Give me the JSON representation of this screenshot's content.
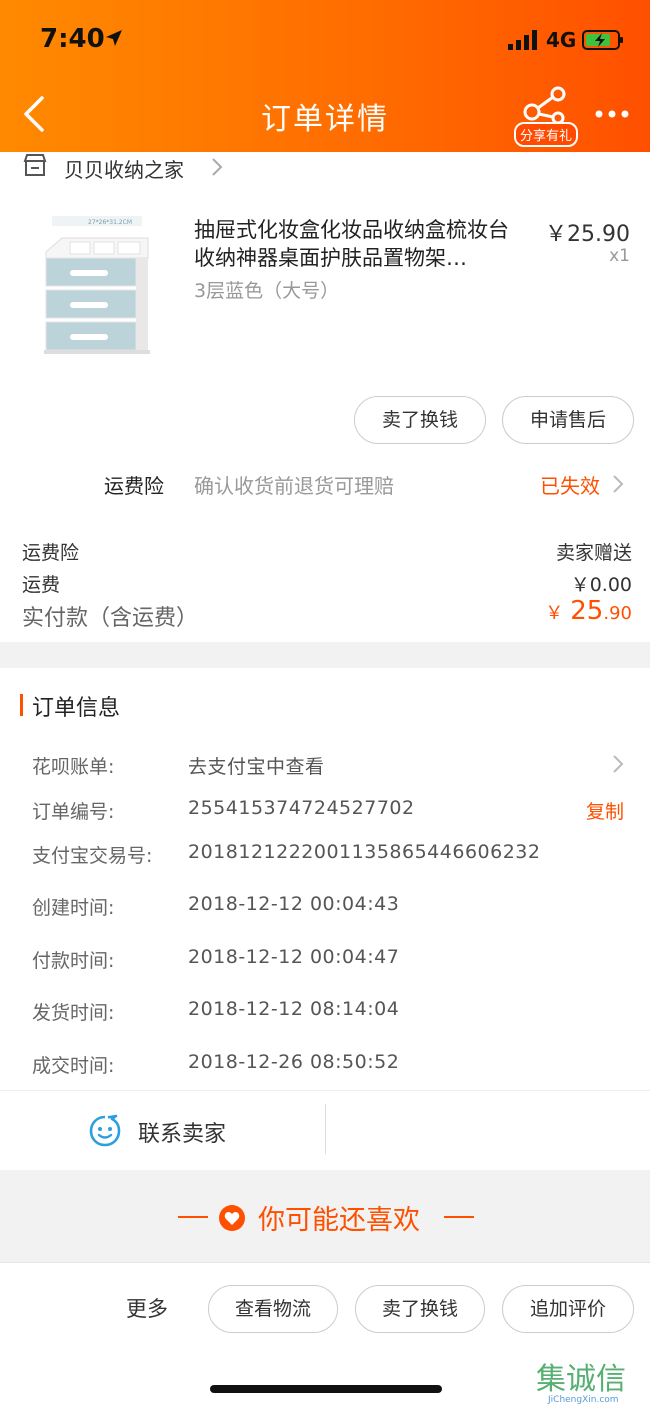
{
  "status_bar": {
    "time": "7:40",
    "network": "4G"
  },
  "nav": {
    "title": "订单详情",
    "share_label": "分享有礼"
  },
  "shop": {
    "name": "贝贝收纳之家"
  },
  "product": {
    "title": "抽屉式化妆盒化妆品收纳盒梳妆台收纳神器桌面护肤品置物架…",
    "variant": "3层蓝色（大号）",
    "price": "￥25.90",
    "qty": "x1",
    "thumb_caption": "27*26*31.2CM"
  },
  "actions": {
    "sell_for_cash": "卖了换钱",
    "after_sale": "申请售后"
  },
  "shipping_insurance": {
    "label": "运费险",
    "desc": "确认收货前退货可理赔",
    "status": "已失效"
  },
  "fees": [
    {
      "label": "运费险",
      "value": "卖家赠送"
    },
    {
      "label": "运费",
      "value": "￥0.00"
    }
  ],
  "total": {
    "label": "实付款（含运费）",
    "currency": "￥",
    "int": "25",
    "dec": ".90"
  },
  "order_info": {
    "title": "订单信息",
    "rows": [
      {
        "label": "花呗账单:",
        "value": "去支付宝中查看"
      },
      {
        "label": "订单编号:",
        "value": "255415374724527702",
        "action": "复制"
      },
      {
        "label": "支付宝交易号:",
        "value": "2018121222001135865446606232"
      },
      {
        "label": "创建时间:",
        "value": "2018-12-12 00:04:43"
      },
      {
        "label": "付款时间:",
        "value": "2018-12-12 00:04:47"
      },
      {
        "label": "发货时间:",
        "value": "2018-12-12 08:14:04"
      },
      {
        "label": "成交时间:",
        "value": "2018-12-26 08:50:52"
      }
    ],
    "contact_label": "联系卖家"
  },
  "recommend": {
    "title": "你可能还喜欢"
  },
  "bottom_bar": {
    "more": "更多",
    "logistics": "查看物流",
    "sell_for_cash": "卖了换钱",
    "add_review": "追加评价"
  },
  "watermark": {
    "text": "集诚信",
    "sub": "JiChengXin.com"
  },
  "colors": {
    "accent": "#ff5000",
    "header_start": "#ff8a00",
    "header_end": "#ff5000"
  }
}
